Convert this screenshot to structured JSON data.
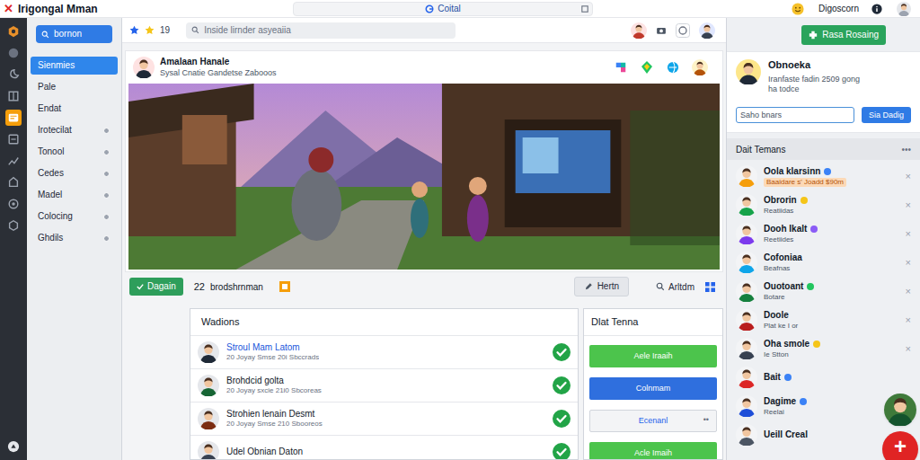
{
  "app": {
    "logo": "✕",
    "title": "Irigongal Mman"
  },
  "topbar": {
    "search_text": "Coital",
    "user": "Digoscorn"
  },
  "rail": {
    "items": [
      {
        "selected": false
      },
      {
        "selected": false
      },
      {
        "selected": false
      },
      {
        "selected": false
      },
      {
        "selected": true
      },
      {
        "selected": false
      },
      {
        "selected": false
      },
      {
        "selected": false
      },
      {
        "selected": false
      },
      {
        "selected": false
      },
      {
        "selected": false
      }
    ]
  },
  "sidebar": {
    "button": "bornon",
    "items": [
      {
        "label": "Sienmies",
        "selected": true,
        "dot": false
      },
      {
        "label": "Pale",
        "selected": false,
        "dot": false
      },
      {
        "label": "Endat",
        "selected": false,
        "dot": false
      },
      {
        "label": "Irotecilat",
        "selected": false,
        "dot": true
      },
      {
        "label": "Tonool",
        "selected": false,
        "dot": true
      },
      {
        "label": "Cedes",
        "selected": false,
        "dot": true
      },
      {
        "label": "Madel",
        "selected": false,
        "dot": true
      },
      {
        "label": "Colocing",
        "selected": false,
        "dot": true
      },
      {
        "label": "Ghdils",
        "selected": false,
        "dot": true
      }
    ]
  },
  "feed": {
    "stars": "19",
    "search_placeholder": "Inside lirnder asyeaiia"
  },
  "post": {
    "author": "Amalaan Hanale",
    "subtitle": "Sysal Cnatie Gandetse Zabooos"
  },
  "actions": {
    "primary": "Dagain",
    "count": "22",
    "count_label": "brodshrnman",
    "edit": "Hertn",
    "search": "Arltdm"
  },
  "wadions": {
    "title": "Wadions",
    "rows": [
      {
        "name": "Stroul Mam Latom",
        "meta": "20 Joyay Smse 20i Sbccrads",
        "link": true,
        "checked": true
      },
      {
        "name": "Brohdcid golta",
        "meta": "20 Joyay sxcie 21i0 Sbcoreas",
        "link": false,
        "checked": true
      },
      {
        "name": "Strohien lenain Desmt",
        "meta": "20 Joyay Smse 210 Sbooreos",
        "link": false,
        "checked": true
      },
      {
        "name": "Udel Obnian Daton",
        "link": false,
        "checked": true
      }
    ]
  },
  "dlat": {
    "title": "Dlat Tenna",
    "buttons": [
      {
        "label": "Aele Iraaih",
        "kind": "green"
      },
      {
        "label": "Colnmam",
        "kind": "blue"
      },
      {
        "label": "Ecenanl",
        "kind": "light",
        "extra": "••"
      },
      {
        "label": "Acle Imaih",
        "kind": "green"
      }
    ]
  },
  "right": {
    "action": "Rasa Rosaing",
    "profile": {
      "name": "Obnoeka",
      "line1": "Iranfaste fadin 2509 gong",
      "line2": "ha todce"
    },
    "search_placeholder": "Saho bnars",
    "search_button": "Sia Dadig",
    "friends_title": "Dait Temans",
    "friends_more": "•••",
    "friends": [
      {
        "name": "Oola klarsinn",
        "badge": "#3b82f6",
        "sub": "Baaidare s' Joadd $90m",
        "highlight": true,
        "close": "×"
      },
      {
        "name": "Obrorin",
        "badge": "#f5c518",
        "sub": "Reatiidas",
        "highlight": false,
        "close": "×"
      },
      {
        "name": "Dooh Ikalt",
        "badge": "#8b5cf6",
        "sub": "Reetiides",
        "highlight": false,
        "close": "×"
      },
      {
        "name": "Cofoniaa",
        "sub": "Beafnas",
        "highlight": false,
        "close": "×"
      },
      {
        "name": "Ouotoant",
        "badge": "#22c55e",
        "sub": "Botare",
        "highlight": false,
        "close": "×"
      },
      {
        "name": "Doole",
        "sub": "Plat ke I or",
        "highlight": false,
        "close": "×"
      },
      {
        "name": "Oha smole",
        "badge": "#f5c518",
        "sub": "Ie Stton",
        "highlight": false,
        "close": "×"
      },
      {
        "name": "Bait",
        "badge": "#3b82f6",
        "highlight": false
      },
      {
        "name": "Dagime",
        "badge": "#3b82f6",
        "sub": "Reelai",
        "highlight": false
      },
      {
        "name": "Ueill Creal",
        "highlight": false
      }
    ]
  },
  "fab": "+"
}
